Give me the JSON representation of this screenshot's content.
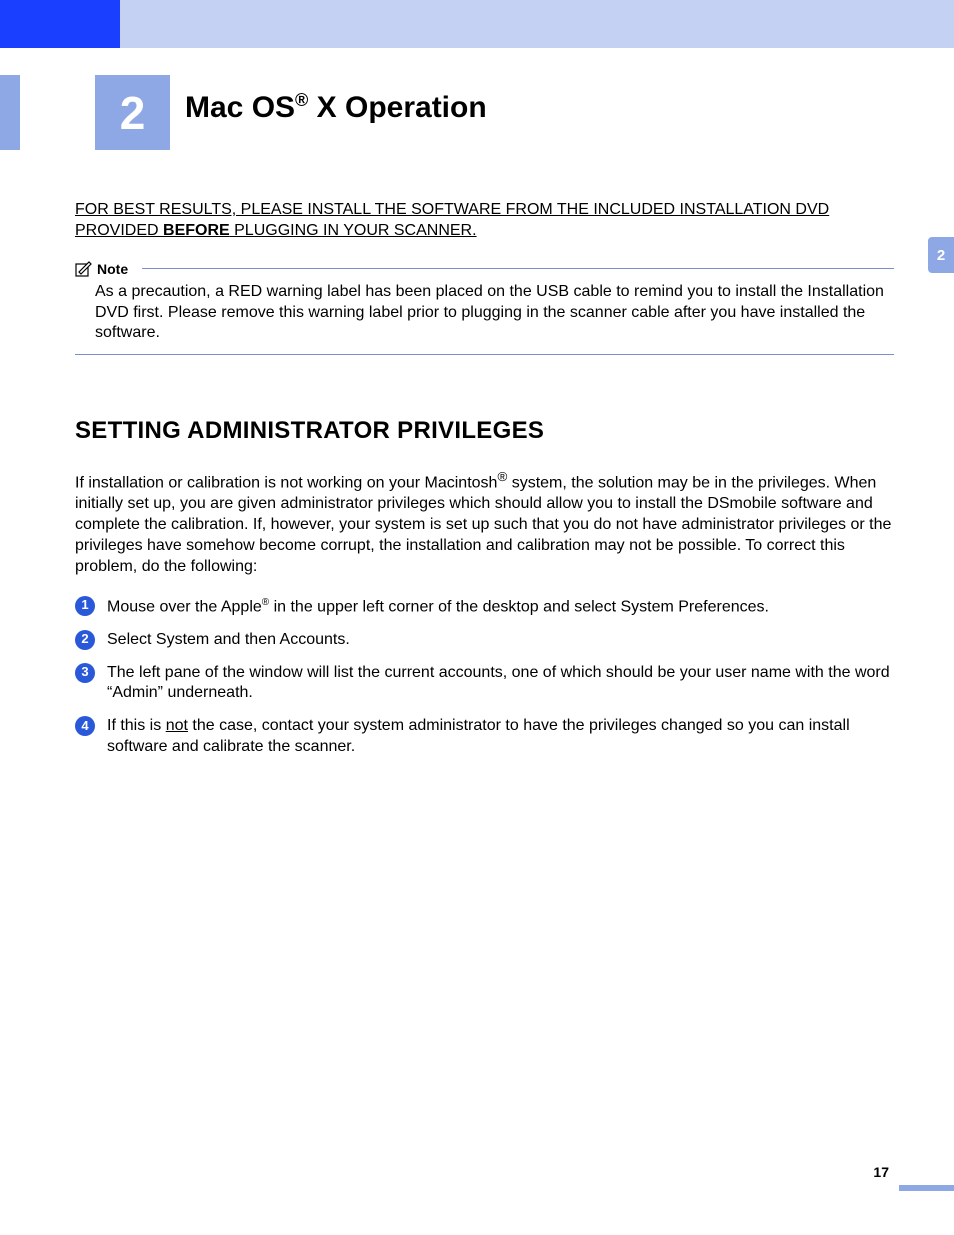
{
  "chapter": {
    "number": "2",
    "title_pre": "Mac OS",
    "title_post": " X Operation"
  },
  "warning": {
    "pre": "FOR BEST RESULTS, PLEASE INSTALL THE SOFTWARE FROM THE INCLUDED INSTALLATION DVD PROVIDED ",
    "bold": "BEFORE",
    "post": " PLUGGING IN YOUR SCANNER."
  },
  "note": {
    "label": "Note",
    "body": "As a precaution, a RED warning label has been placed on the USB cable to remind you to install the Installation DVD first. Please remove this warning label prior to plugging in the scanner cable after you have installed the software."
  },
  "section": {
    "heading": "SETTING ADMINISTRATOR PRIVILEGES",
    "intro_pre": "If installation or calibration is not working on your Macintosh",
    "intro_post": " system, the solution may be in the privileges. When initially set up, you are given administrator privileges which should allow you to install the DSmobile software and complete the calibration. If, however, your system is set up such that you do not have administrator privileges or the privileges have somehow become corrupt, the installation and calibration may not be possible. To correct this problem, do the following:"
  },
  "steps": [
    {
      "n": "1",
      "pre": "Mouse over the Apple",
      "post": " in the upper left corner of the desktop and select System Preferences.",
      "sup": "®"
    },
    {
      "n": "2",
      "text": "Select System and then Accounts."
    },
    {
      "n": "3",
      "text": "The left pane of the window will list the current accounts, one of which should be your user name with the word “Admin” underneath."
    },
    {
      "n": "4",
      "pre4": "If this is ",
      "u": "not",
      "post4": " the case, contact your system administrator to have the privileges changed so you can install software and calibrate the scanner."
    }
  ],
  "sideTab": "2",
  "pageNumber": "17"
}
